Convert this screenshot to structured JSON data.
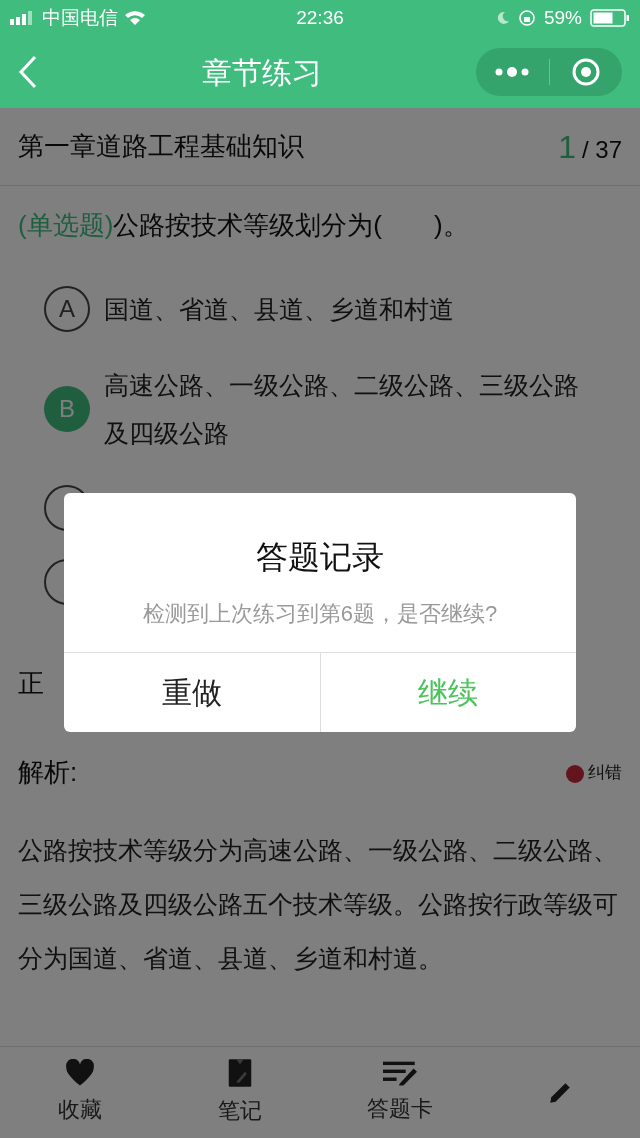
{
  "status_bar": {
    "carrier": "中国电信",
    "time": "22:36",
    "battery": "59%"
  },
  "nav": {
    "title": "章节练习"
  },
  "chapter": {
    "title": "第一章道路工程基础知识",
    "current": "1",
    "total": "/ 37"
  },
  "question": {
    "type": "(单选题)",
    "text": "公路按技术等级划分为(　　)。"
  },
  "options": [
    {
      "letter": "A",
      "text": "国道、省道、县道、乡道和村道",
      "selected": false
    },
    {
      "letter": "B",
      "text": "高速公路、一级公路、二级公路、三级公路及四级公路",
      "selected": true
    },
    {
      "selected": false
    },
    {
      "selected": false
    }
  ],
  "answer_label": "正",
  "analysis": {
    "label": "解析:",
    "report": "纠错",
    "text": "公路按技术等级分为高速公路、一级公路、二级公路、三级公路及四级公路五个技术等级。公路按行政等级可分为国道、省道、县道、乡道和村道。"
  },
  "tabs": [
    {
      "kind": "heart",
      "label": "收藏"
    },
    {
      "kind": "note",
      "label": "笔记"
    },
    {
      "kind": "card",
      "label": "答题卡"
    },
    {
      "kind": "pencil"
    }
  ],
  "dialog": {
    "title": "答题记录",
    "message": "检测到上次练习到第6题，是否继续?",
    "buttons": [
      {
        "label": "重做",
        "primary": false
      },
      {
        "label": "继续",
        "primary": true
      }
    ]
  }
}
